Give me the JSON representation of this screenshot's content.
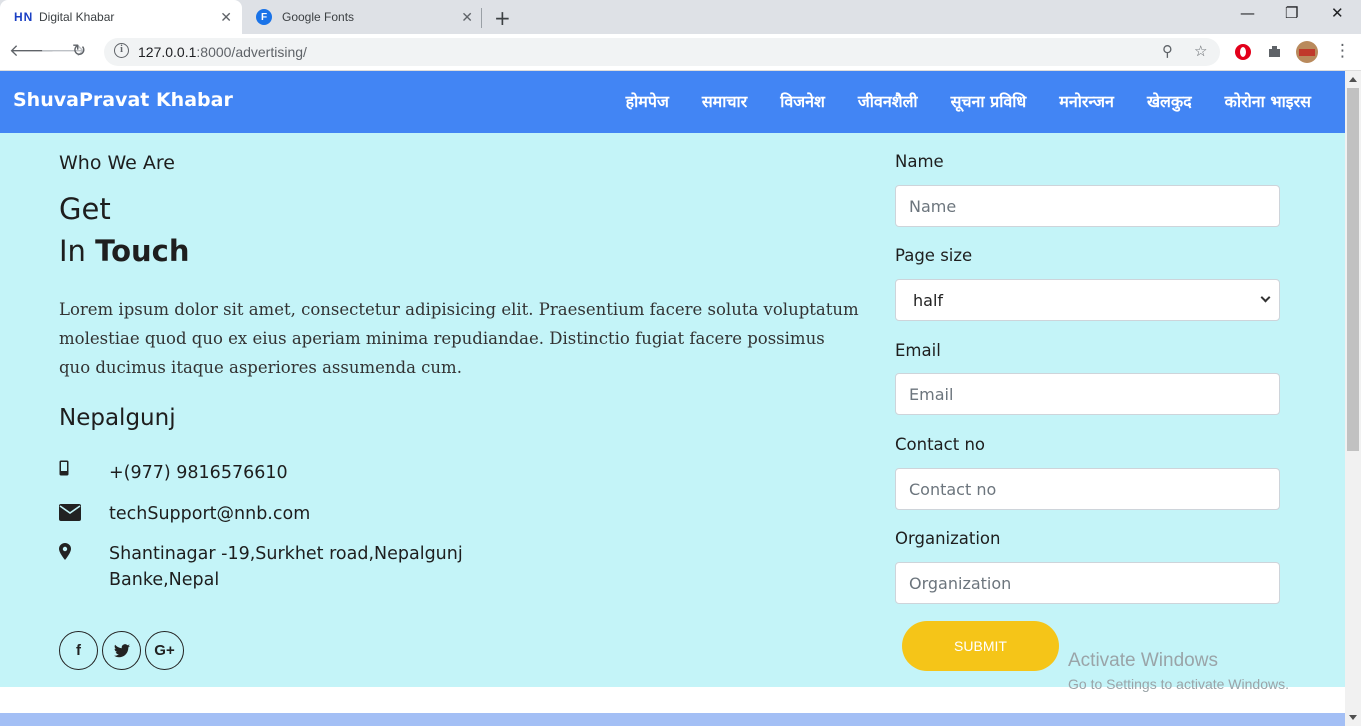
{
  "browser": {
    "tabs": [
      {
        "favicon": "HN",
        "title": "Digital Khabar",
        "active": true
      },
      {
        "favicon": "F",
        "title": "Google Fonts",
        "active": false
      }
    ],
    "url_host": "127.0.0.1",
    "url_rest": ":8000/advertising/",
    "icons": [
      "back-icon",
      "forward-icon",
      "reload-icon",
      "info-icon",
      "zoom-icon",
      "star-icon",
      "opera-icon",
      "extensions-icon",
      "avatar",
      "menu-icon"
    ]
  },
  "navbar": {
    "brand": "ShuvaPravat Khabar",
    "links": [
      "होमपेज",
      "समाचार",
      "विजनेश",
      "जीवनशैली",
      "सूचना प्रविधि",
      "मनोरन्जन",
      "खेलकुद",
      "कोरोना भाइरस"
    ]
  },
  "contact": {
    "eyebrow": "Who We Are",
    "heading_line1": "Get",
    "heading_in": "In ",
    "heading_bold": "Touch",
    "body": "Lorem ipsum dolor sit amet, consectetur adipisicing elit. Praesentium facere soluta voluptatum molestiae quod quo ex eius aperiam minima repudiandae. Distinctio fugiat facere possimus quo ducimus itaque asperiores assumenda cum.",
    "city": "Nepalgunj",
    "phone": "+(977) 9816576610",
    "email": "techSupport@nnb.com",
    "address_line1": "Shantinagar -19,Surkhet road,Nepalgunj",
    "address_line2": "Banke,Nepal",
    "socials": [
      "facebook-icon",
      "twitter-icon",
      "google-plus-icon"
    ]
  },
  "form": {
    "name_label": "Name",
    "name_placeholder": "Name",
    "page_size_label": "Page size",
    "page_size_value": "half",
    "email_label": "Email",
    "email_placeholder": "Email",
    "contact_label": "Contact no",
    "contact_placeholder": "Contact no",
    "org_label": "Organization",
    "org_placeholder": "Organization",
    "submit_label": "SUBMIT"
  },
  "watermark": {
    "line1": "Activate Windows",
    "line2": "Go to Settings to activate Windows."
  },
  "colors": {
    "navbar": "#4285f4",
    "section_bg": "#c4f4f8",
    "submit": "#f5c518"
  }
}
